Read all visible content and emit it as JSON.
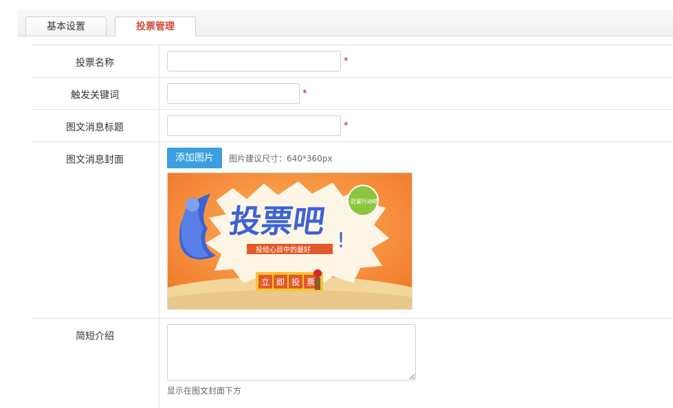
{
  "tabs": [
    {
      "label": "基本设置"
    },
    {
      "label": "投票管理"
    }
  ],
  "form": {
    "vote_name": {
      "label": "投票名称",
      "value": "",
      "required": "*"
    },
    "keyword": {
      "label": "触发关键词",
      "value": "",
      "required": "*"
    },
    "msg_title": {
      "label": "图文消息标题",
      "value": "",
      "required": "*"
    },
    "cover": {
      "label": "图文消息封面",
      "button": "添加图片",
      "hint": "图片建议尺寸：640*360px",
      "image_text": {
        "headline": "投票吧",
        "subline": "投给心目中的最好",
        "badge": "赶紧行动吧",
        "vote_buttons": [
          "立",
          "即",
          "投",
          "票"
        ]
      }
    },
    "intro": {
      "label": "简短介绍",
      "value": "",
      "hint": "显示在图文封面下方"
    }
  },
  "colors": {
    "accent": "#3a9ee0",
    "active_tab": "#d24b3b",
    "required": "#cc0000",
    "banner_orange": "#f58a3a"
  }
}
